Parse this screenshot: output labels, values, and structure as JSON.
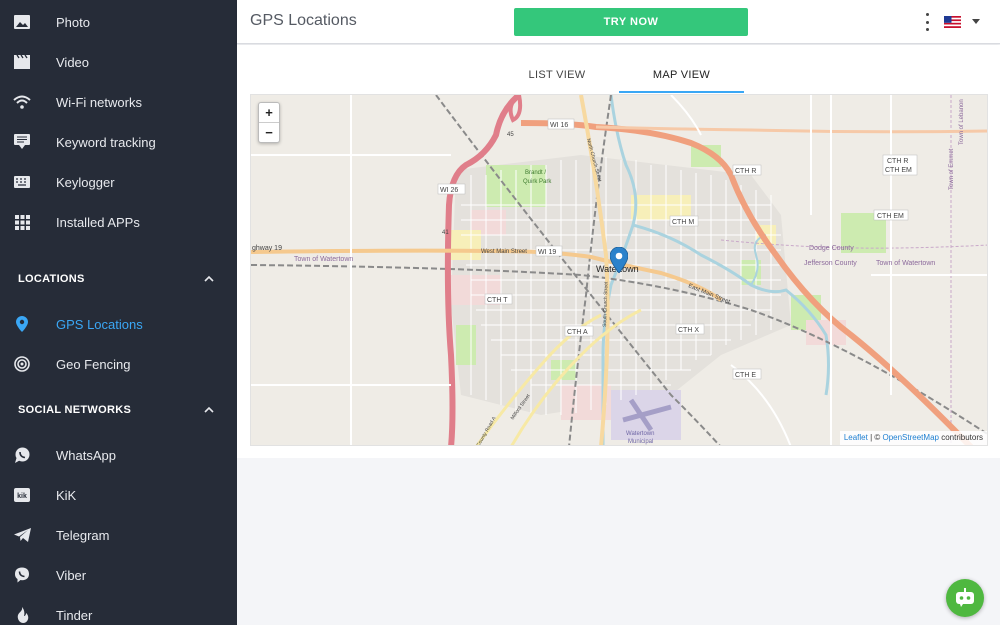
{
  "sidebar": {
    "items": [
      {
        "label": "Photo",
        "icon": "photo-icon"
      },
      {
        "label": "Video",
        "icon": "video-icon"
      },
      {
        "label": "Wi-Fi networks",
        "icon": "wifi-icon"
      },
      {
        "label": "Keyword tracking",
        "icon": "keyword-icon"
      },
      {
        "label": "Keylogger",
        "icon": "keyboard-icon"
      },
      {
        "label": "Installed APPs",
        "icon": "apps-grid-icon"
      }
    ],
    "locations": {
      "title": "LOCATIONS",
      "items": [
        {
          "label": "GPS Locations",
          "icon": "location-pin-icon",
          "active": true
        },
        {
          "label": "Geo Fencing",
          "icon": "target-icon"
        }
      ]
    },
    "social": {
      "title": "SOCIAL NETWORKS",
      "items": [
        {
          "label": "WhatsApp",
          "icon": "whatsapp-icon"
        },
        {
          "label": "KiK",
          "icon": "kik-icon"
        },
        {
          "label": "Telegram",
          "icon": "telegram-icon"
        },
        {
          "label": "Viber",
          "icon": "viber-icon"
        },
        {
          "label": "Tinder",
          "icon": "tinder-icon"
        }
      ]
    }
  },
  "header": {
    "title": "GPS Locations",
    "try_now": "TRY NOW",
    "flag": "us-flag-icon"
  },
  "tabs": {
    "list": "LIST VIEW",
    "map": "MAP VIEW",
    "active": "MAP VIEW"
  },
  "map": {
    "zoom_in": "+",
    "zoom_out": "−",
    "attribution_leaflet": "Leaflet",
    "attribution_sep": " | © ",
    "attribution_osm": "OpenStreetMap",
    "attribution_contributors": " contributors",
    "labels": {
      "wi16": "WI 16",
      "wi26": "WI 26",
      "wi19": "WI 19",
      "hwy19": "ghway 19",
      "r45": "45",
      "r41": "41",
      "west_main": "West Main Street",
      "east_main": "East Main Street",
      "brandt": "Brandt /",
      "quirk": "Quirk Park",
      "town_watertown_w": "Town of Watertown",
      "town_watertown_e": "Town of Watertown",
      "watertown": "Watertown",
      "cth_r": "CTH R",
      "cth_r2": "CTH R",
      "cth_em": "CTH EM",
      "cth_em2": "CTH EM",
      "cth_m": "CTH M",
      "cth_t": "CTH T",
      "cth_a": "CTH A",
      "cth_x": "CTH X",
      "cth_e": "CTH E",
      "dodge": "Dodge County",
      "jefferson": "Jefferson County",
      "north_church": "North Church Street",
      "south_church": "South Church Street",
      "milford": "Milford Street",
      "county_a": "County Road A",
      "town_lebanon": "Town of Lebanon",
      "town_emmet": "Town of Emmet",
      "airport1": "Watertown",
      "airport2": "Municipal"
    }
  },
  "colors": {
    "sidebar_bg": "#262c38",
    "accent": "#3aa7f5",
    "try_now": "#34c77b",
    "chat": "#4fb840"
  }
}
